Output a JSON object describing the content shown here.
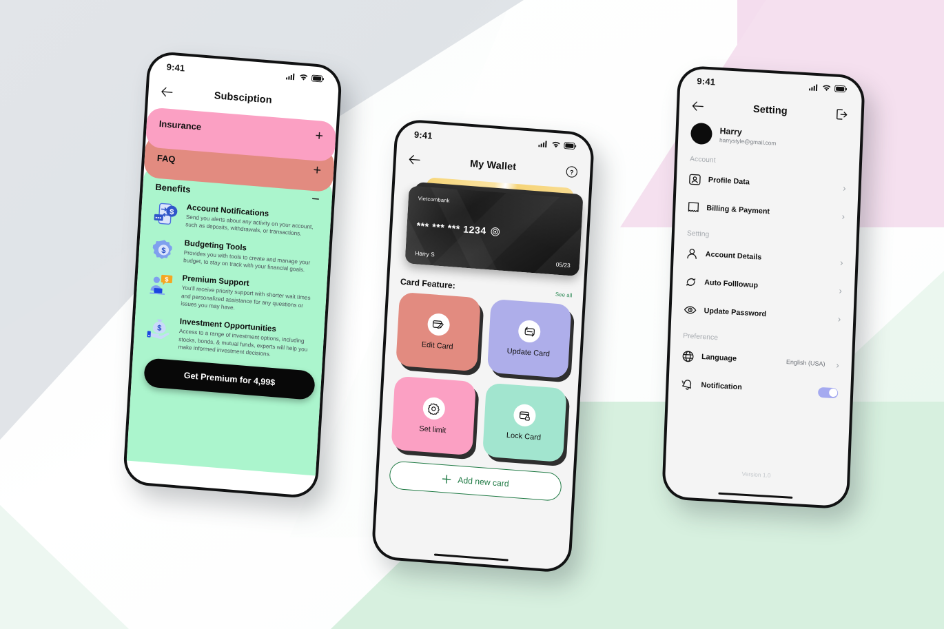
{
  "background": {
    "gray": "#e1e4e8",
    "pink": "#f4ddee",
    "green": "#d7f0df",
    "white": "#ffffff"
  },
  "phone1": {
    "status": {
      "time": "9:41",
      "signal_icon": "cellular-signal-icon",
      "wifi_icon": "wifi-icon",
      "battery_icon": "battery-icon"
    },
    "nav": {
      "back_icon": "arrow-left-icon",
      "title": "Subsciption"
    },
    "accordions": [
      {
        "title": "Insurance",
        "sign": "+",
        "color": "#fba0c3",
        "expanded": false
      },
      {
        "title": "FAQ",
        "sign": "+",
        "color": "#e28b80",
        "expanded": false
      },
      {
        "title": "Benefits",
        "sign": "−",
        "color": "#abf5cd",
        "expanded": true
      }
    ],
    "benefits": [
      {
        "icon": "phone-transfer-dollar-icon",
        "heading": "Account Notifications",
        "body": "Send you alerts about any activity on your account, such as deposits, withdrawals, or transactions."
      },
      {
        "icon": "gear-dollar-icon",
        "heading": "Budgeting Tools",
        "body": "Provides you with tools to create and manage your budget, to stay on track with your financial goals."
      },
      {
        "icon": "support-agent-icon",
        "heading": "Premium Support",
        "body": "You'll receive priority support with shorter wait times and personalized assistance for any questions or issues you may have."
      },
      {
        "icon": "money-bag-hand-icon",
        "heading": "Investment Opportunities",
        "body": "Access to a range of investment options, including stocks, bonds, & mutual funds, experts will help you make informed investment decisions."
      }
    ],
    "cta": "Get Premium for 4,99$"
  },
  "phone2": {
    "status": {
      "time": "9:41",
      "signal_icon": "cellular-signal-icon",
      "wifi_icon": "wifi-icon",
      "battery_icon": "battery-icon"
    },
    "nav": {
      "back_icon": "arrow-left-icon",
      "title": "My Wallet",
      "help_icon": "help-circle-icon"
    },
    "card": {
      "bank": "Vietcombank",
      "number": "*** *** *** 1234",
      "copy_icon": "copy-target-icon",
      "holder": "Harry S",
      "expiry": "05/23"
    },
    "features_label": "Card Feature:",
    "see_all": "See all",
    "tiles": [
      {
        "label": "Edit Card",
        "icon": "card-edit-icon",
        "color": "#e28b80"
      },
      {
        "label": "Update Card",
        "icon": "card-sync-icon",
        "color": "#aeaeea"
      },
      {
        "label": "Set limit",
        "icon": "gear-icon",
        "color": "#fba0c3"
      },
      {
        "label": "Lock Card",
        "icon": "card-lock-icon",
        "color": "#a2e5cf"
      }
    ],
    "add_card": {
      "label": "Add new card",
      "icon": "plus-icon"
    }
  },
  "phone3": {
    "status": {
      "time": "9:41",
      "signal_icon": "cellular-signal-icon",
      "wifi_icon": "wifi-icon",
      "battery_icon": "battery-icon"
    },
    "nav": {
      "back_icon": "arrow-left-icon",
      "title": "Setting",
      "logout_icon": "logout-icon"
    },
    "profile": {
      "name": "Harry",
      "email": "harrystyle@gmail.com",
      "avatar_icon": "avatar"
    },
    "sections": [
      {
        "title": "Account",
        "rows": [
          {
            "label": "Profile Data",
            "icon": "profile-card-icon",
            "chevron": "›"
          },
          {
            "label": "Billing & Payment",
            "icon": "receipt-icon",
            "chevron": "›"
          }
        ]
      },
      {
        "title": "Setting",
        "rows": [
          {
            "label": "Account Details",
            "icon": "person-icon",
            "chevron": "›"
          },
          {
            "label": "Auto Folllowup",
            "icon": "refresh-icon",
            "chevron": "›"
          },
          {
            "label": "Update Password",
            "icon": "eye-icon",
            "chevron": "›"
          }
        ]
      },
      {
        "title": "Preference",
        "rows": [
          {
            "label": "Language",
            "icon": "globe-icon",
            "value": "English (USA)",
            "chevron": "›"
          },
          {
            "label": "Notification",
            "icon": "bell-icon",
            "toggle": true,
            "toggle_on": true
          }
        ]
      }
    ],
    "version": "Version 1.0",
    "toggle_color": "#a5aaf0"
  }
}
